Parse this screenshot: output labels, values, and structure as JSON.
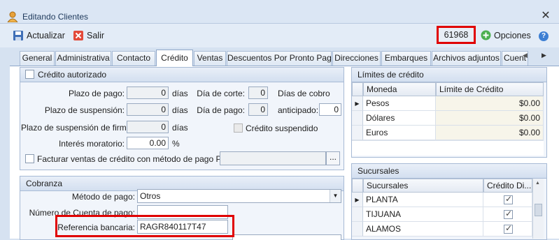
{
  "window": {
    "title": "Editando Clientes",
    "close": "✕"
  },
  "toolbar": {
    "update": "Actualizar",
    "exit": "Salir",
    "folio": "61968",
    "options": "Opciones",
    "help": "?"
  },
  "tabs": [
    "General",
    "Administrativa",
    "Contacto",
    "Crédito",
    "Ventas",
    "Descuentos Por Pronto Pago",
    "Direcciones",
    "Embarques",
    "Archivos adjuntos",
    "Cuent"
  ],
  "credit": {
    "authorized_label": "Crédito autorizado",
    "plazo_pago_label": "Plazo de pago:",
    "plazo_pago_value": "0",
    "plazo_susp_label": "Plazo de suspensión:",
    "plazo_susp_value": "0",
    "plazo_susp_firma_label": "Plazo de suspensión de firma:",
    "plazo_susp_firma_value": "0",
    "interes_label": "Interés moratorio:",
    "interes_value": "0.00",
    "percent": "%",
    "days": "días",
    "dia_corte_label": "Día de corte:",
    "dia_corte_value": "0",
    "dias_cobro_label": "Días de cobro",
    "dia_pago_label": "Día de pago:",
    "dia_pago_value": "0",
    "anticipado_label": "anticipado:",
    "anticipado_value": "0",
    "suspendido_label": "Crédito suspendido",
    "pue_label": "Facturar ventas de crédito con método de pago PUE",
    "ellipsis": "..."
  },
  "cobranza": {
    "header": "Cobranza",
    "metodo_label": "Método de pago:",
    "metodo_value": "Otros",
    "cuenta_label": "Número de Cuenta de pago:",
    "cuenta_value": "",
    "referencia_label": "Referencia bancaria:",
    "referencia_value": "RAGR840117T47"
  },
  "limites": {
    "header": "Límites de crédito",
    "columns": [
      "Moneda",
      "Límite de Crédito"
    ],
    "rows": [
      {
        "moneda": "Pesos",
        "limite": "$0.00"
      },
      {
        "moneda": "Dólares",
        "limite": "$0.00"
      },
      {
        "moneda": "Euros",
        "limite": "$0.00"
      }
    ]
  },
  "sucursales": {
    "header": "Sucursales",
    "columns": [
      "Sucursales",
      "Crédito Di..."
    ],
    "rows": [
      {
        "name": "PLANTA",
        "checked": true
      },
      {
        "name": "TIJUANA",
        "checked": true
      },
      {
        "name": "ALAMOS",
        "checked": true
      }
    ]
  },
  "colors": {
    "highlight": "#e00000",
    "accent": "#3d7fd3"
  }
}
